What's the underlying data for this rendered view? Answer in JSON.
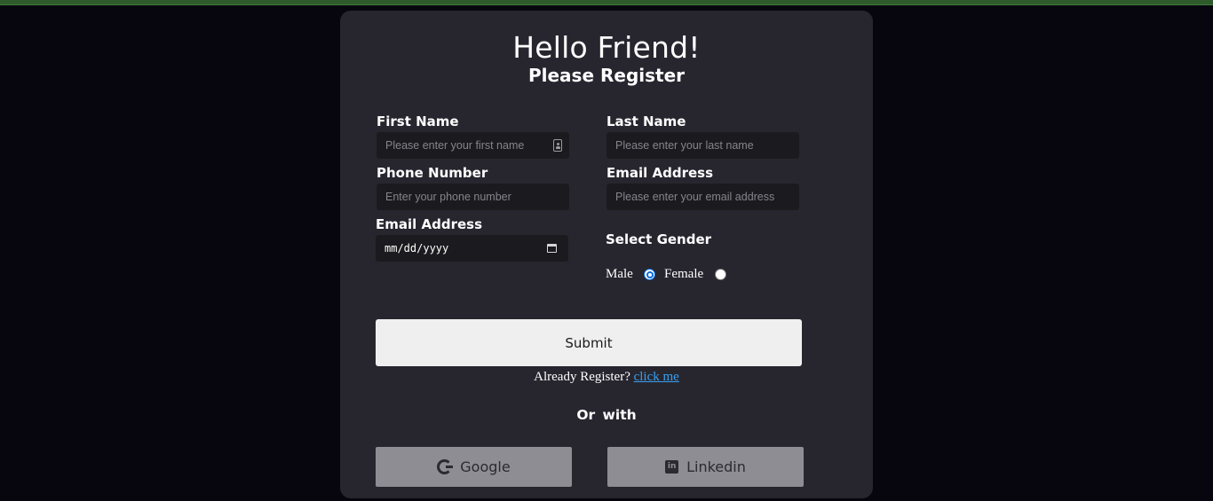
{
  "header": {
    "title": "Hello Friend!",
    "subtitle": "Please Register"
  },
  "form": {
    "first_name": {
      "label": "First Name",
      "placeholder": "Please enter your first name"
    },
    "last_name": {
      "label": "Last Name",
      "placeholder": "Please enter your last name"
    },
    "phone": {
      "label": "Phone Number",
      "placeholder": "Enter your phone number"
    },
    "email": {
      "label": "Email Address",
      "placeholder": "Please enter your email address"
    },
    "date": {
      "label": "Email Address",
      "value": "mm/dd/yyyy"
    },
    "gender": {
      "label": "Select Gender",
      "options": [
        {
          "label": "Male",
          "checked": true
        },
        {
          "label": "Female",
          "checked": false
        }
      ]
    },
    "submit_label": "Submit"
  },
  "footer": {
    "already_text": "Already Register?",
    "link_text": "click me",
    "or_with": "Or with",
    "google_label": "Google",
    "linkedin_label": "Linkedin"
  },
  "icons": {
    "first_name_field": "contact-card-icon",
    "date_field": "calendar-icon",
    "google": "google-icon",
    "linkedin": "linkedin-icon"
  },
  "colors": {
    "background": "#07060e",
    "card": "#27262f",
    "input": "#1b1b1f",
    "top_bar": "#2e5b2c",
    "link": "#3aa1f0",
    "radio_checked": "#0b6bdf",
    "social_button": "#8e8d93"
  }
}
